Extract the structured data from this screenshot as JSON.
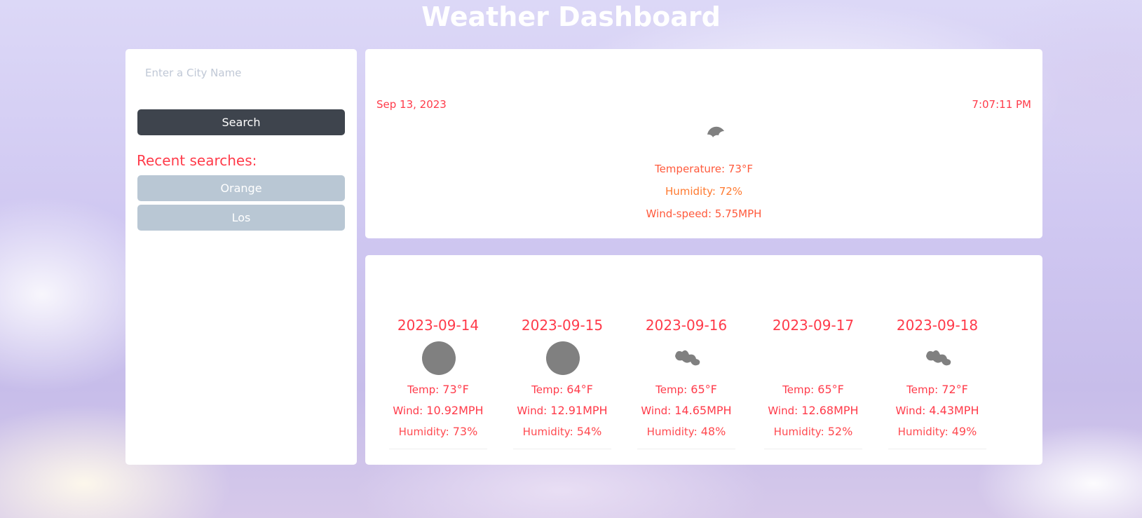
{
  "header": {
    "title": "Weather Dashboard"
  },
  "sidebar": {
    "search_placeholder": "Enter a City Name",
    "search_button": "Search",
    "recent_label": "Recent searches:",
    "recent": [
      "Orange",
      "Los"
    ]
  },
  "current": {
    "date": "Sep 13, 2023",
    "time": "7:07:11 PM",
    "icon": "cloudy-night-icon",
    "temperature": "Temperature: 73°F",
    "humidity": "Humidity: 72%",
    "wind": "Wind-speed: 5.75MPH"
  },
  "forecast": [
    {
      "date": "2023-09-14",
      "icon": "moon-icon",
      "temp_label": "Temp:",
      "temp": "73°F",
      "wind_label": "Wind:",
      "wind": "10.92MPH",
      "humidity_label": "Humidity:",
      "humidity": "73%"
    },
    {
      "date": "2023-09-15",
      "icon": "moon-icon",
      "temp_label": "Temp:",
      "temp": "64°F",
      "wind_label": "Wind:",
      "wind": "12.91MPH",
      "humidity_label": "Humidity:",
      "humidity": "54%"
    },
    {
      "date": "2023-09-16",
      "icon": "clouds-icon",
      "temp_label": "Temp:",
      "temp": "65°F",
      "wind_label": "Wind:",
      "wind": "14.65MPH",
      "humidity_label": "Humidity:",
      "humidity": "48%"
    },
    {
      "date": "2023-09-17",
      "icon": "",
      "temp_label": "Temp:",
      "temp": "65°F",
      "wind_label": "Wind:",
      "wind": "12.68MPH",
      "humidity_label": "Humidity:",
      "humidity": "52%"
    },
    {
      "date": "2023-09-18",
      "icon": "clouds-icon",
      "temp_label": "Temp:",
      "temp": "72°F",
      "wind_label": "Wind:",
      "wind": "4.43MPH",
      "humidity_label": "Humidity:",
      "humidity": "49%"
    }
  ],
  "colors": {
    "accent": "#ff3b4a",
    "button_dark": "#3e444d",
    "recent_button": "#b9c7d4",
    "icon_gray": "#808080"
  }
}
